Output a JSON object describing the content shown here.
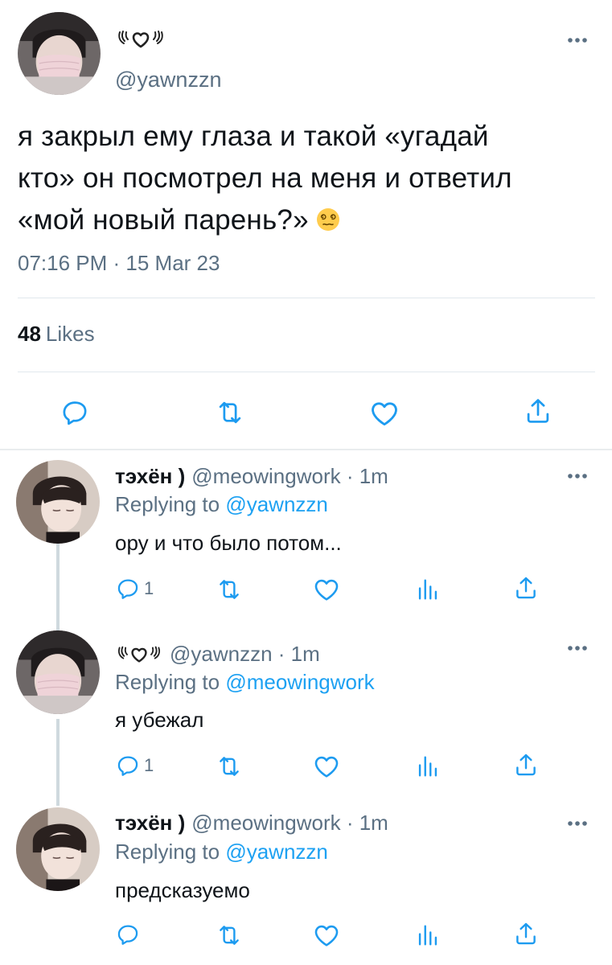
{
  "main_tweet": {
    "display_name_icon": "wings-heart-icon",
    "handle": "@yawnzzn",
    "text_lines": [
      "я закрыл ему глаза и такой «угадай",
      "кто» он посмотрел на меня и ответил",
      "«мой новый парень?»"
    ],
    "emoji": "woozy-face-emoji",
    "timestamp": "07:16 PM · 15 Mar 23",
    "likes_count": "48",
    "likes_label": "Likes",
    "actions": [
      "reply-icon",
      "retweet-icon",
      "like-icon",
      "share-icon"
    ]
  },
  "replies": [
    {
      "name": "тэхён )",
      "handle": "@meowingwork · 1m",
      "replying_prefix": "Replying to",
      "replying_to": "@yawnzzn",
      "text": "ору и что было потом...",
      "reply_count": "1"
    },
    {
      "name_icon": "wings-heart-icon",
      "handle": "@yawnzzn · 1m",
      "replying_prefix": "Replying to",
      "replying_to": "@meowingwork",
      "text": "я убежал",
      "reply_count": "1"
    },
    {
      "name": "тэхён )",
      "handle": "@meowingwork · 1m",
      "replying_prefix": "Replying to",
      "replying_to": "@yawnzzn",
      "text": "предсказуемо",
      "reply_count": ""
    }
  ],
  "colors": {
    "text": "#0f1419",
    "secondary": "#5b7083",
    "link": "#1da1f2",
    "divider": "#e1e8ed",
    "action_icon": "#1d9bf0"
  }
}
